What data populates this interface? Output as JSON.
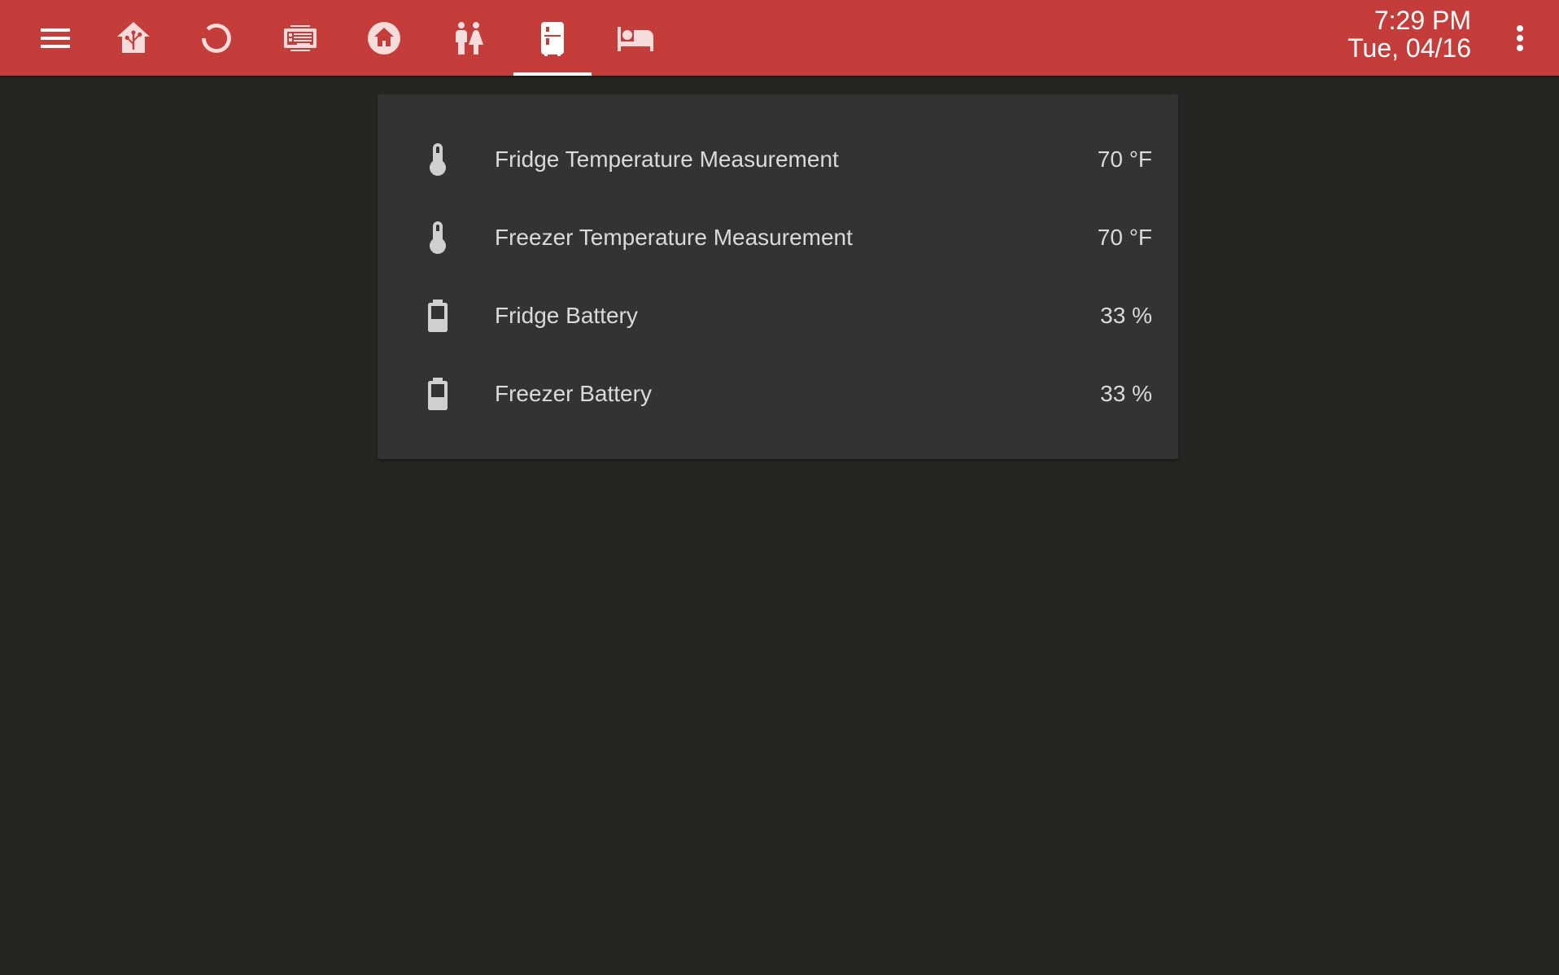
{
  "theme": {
    "toolbar_color": "#c43d3b",
    "background_color": "#252622",
    "card_color": "#333333",
    "text_color": "#dadada"
  },
  "toolbar": {
    "menu_icon": "menu-icon",
    "tabs": [
      {
        "icon": "home-assistant-icon",
        "active": false
      },
      {
        "icon": "circle-notch-icon",
        "active": false
      },
      {
        "icon": "server-rack-icon",
        "active": false
      },
      {
        "icon": "home-circle-icon",
        "active": false
      },
      {
        "icon": "human-male-female-icon",
        "active": false
      },
      {
        "icon": "fridge-icon",
        "active": true
      },
      {
        "icon": "bed-icon",
        "active": false
      }
    ],
    "time": "7:29 PM",
    "date": "Tue, 04/16",
    "overflow_icon": "dots-vertical-icon"
  },
  "entities": [
    {
      "icon": "thermometer-icon",
      "name": "Fridge Temperature Measurement",
      "state": "70 °F"
    },
    {
      "icon": "thermometer-icon",
      "name": "Freezer Temperature Measurement",
      "state": "70 °F"
    },
    {
      "icon": "battery-icon",
      "name": "Fridge Battery",
      "state": "33 %"
    },
    {
      "icon": "battery-icon",
      "name": "Freezer Battery",
      "state": "33 %"
    }
  ]
}
